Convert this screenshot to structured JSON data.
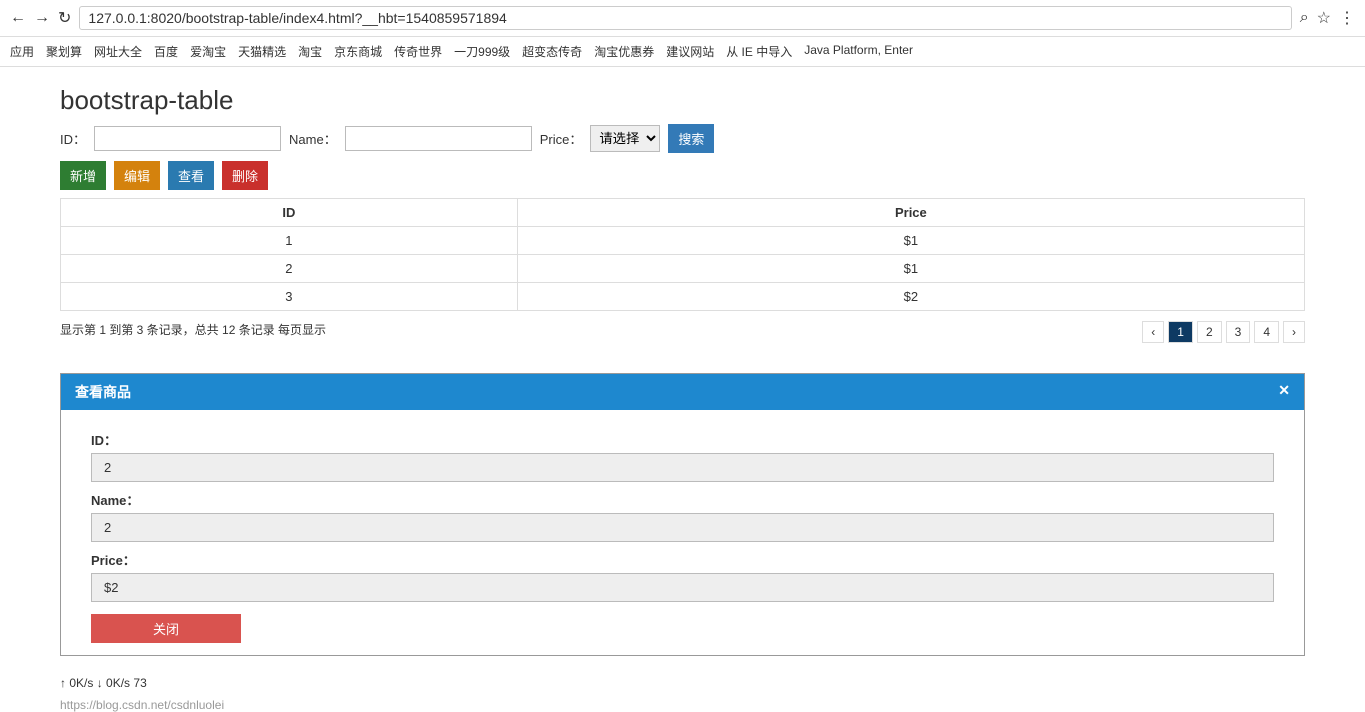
{
  "browser": {
    "url": "127.0.0.1:8020/bootstrap-table/index4.html?__hbt=1540859571894",
    "bookmarks": [
      "应用",
      "聚划算",
      "网址大全",
      "百度",
      "爱淘宝",
      "天猫精选",
      "淘宝",
      "京东商城",
      "传奇世界",
      "一刀999级",
      "超变态传奇",
      "淘宝优惠券",
      "建议网站",
      "从 IE 中导入",
      "Java Platform, Enter"
    ]
  },
  "page": {
    "title": "bootstrap-table",
    "filters": {
      "id_label": "ID：",
      "name_label": "Name：",
      "price_label": "Price：",
      "price_placeholder": "请选择",
      "search_label": "搜索"
    },
    "toolbar": {
      "add": "新增",
      "edit": "编辑",
      "view": "查看",
      "delete": "删除"
    },
    "table": {
      "headers": [
        "ID",
        "Price"
      ],
      "rows": [
        {
          "id": "1",
          "price": "$1"
        },
        {
          "id": "2",
          "price": "$1"
        },
        {
          "id": "3",
          "price": "$2"
        }
      ]
    },
    "pagination_info": "显示第 1 到第 3 条记录，总共 12 条记录 每页显示",
    "pager": [
      "‹",
      "1",
      "2",
      "3",
      "4",
      "›"
    ]
  },
  "modal": {
    "title": "查看商品",
    "id_label": "ID：",
    "id_value": "2",
    "name_label": "Name：",
    "name_value": "2",
    "price_label": "Price：",
    "price_value": "$2",
    "close_label": "关闭"
  },
  "netmeter": {
    "up": "0K/s",
    "down": "0K/s",
    "percent": "73"
  },
  "watermark": "https://blog.csdn.net/csdnluolei"
}
